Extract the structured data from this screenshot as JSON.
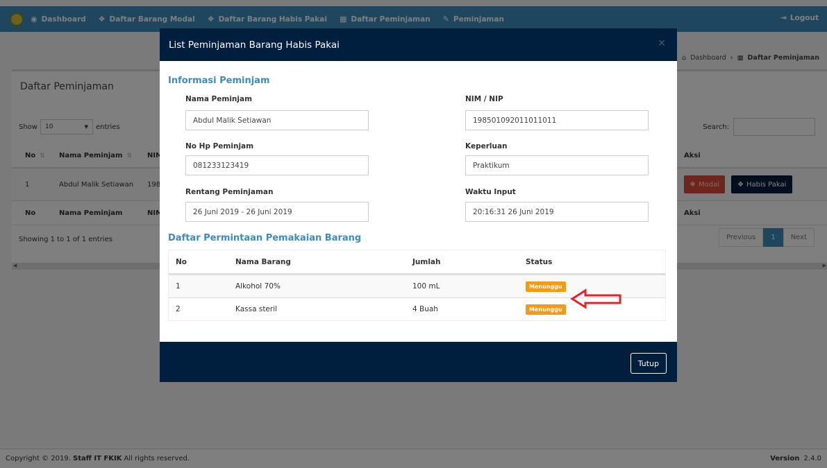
{
  "nav": {
    "items": [
      {
        "label": "Dashboard",
        "icon": "dashboard-icon"
      },
      {
        "label": "Daftar Barang Modal",
        "icon": "cubes-icon"
      },
      {
        "label": "Daftar Barang Habis Pakai",
        "icon": "cubes-icon"
      },
      {
        "label": "Daftar Peminjaman",
        "icon": "grid-icon"
      },
      {
        "label": "Peminjaman",
        "icon": "pencil-icon"
      }
    ],
    "logout": "Logout"
  },
  "breadcrumb": {
    "home": "Dashboard",
    "current": "Daftar Peminjaman"
  },
  "page": {
    "box_title": "Daftar Peminjaman",
    "show_label": "Show",
    "show_value": "10",
    "entries_label": "entries",
    "search_label": "Search:",
    "columns": {
      "no": "No",
      "nama": "Nama Peminjam",
      "nim": "NIM",
      "aksi": "Aksi"
    },
    "row": {
      "no": "1",
      "nama": "Abdul Malik Setiawan",
      "nim": "198"
    },
    "btn_modal": "Modal",
    "btn_habis": "Habis Pakai",
    "showing": "Showing 1 to 1 of 1 entries",
    "pagination": {
      "prev": "Previous",
      "page": "1",
      "next": "Next"
    }
  },
  "footer": {
    "copyright_prefix": "Copyright © 2019.",
    "owner": "Staff IT FKIK",
    "rights": "All rights reserved.",
    "version_label": "Version",
    "version": "2.4.0"
  },
  "modal": {
    "title": "List Peminjaman Barang Habis Pakai",
    "close": "×",
    "info_title": "Informasi Peminjam",
    "fields": {
      "nama_label": "Nama Peminjam",
      "nama_value": "Abdul Malik Setiawan",
      "nim_label": "NIM / NIP",
      "nim_value": "198501092011011011",
      "hp_label": "No Hp Peminjam",
      "hp_value": "081233123419",
      "keperluan_label": "Keperluan",
      "keperluan_value": "Praktikum",
      "rentang_label": "Rentang Peminjaman",
      "rentang_value": "26 Juni 2019 - 26 Juni 2019",
      "waktu_label": "Waktu Input",
      "waktu_value": "20:16:31 26 Juni 2019"
    },
    "list_title": "Daftar Permintaan Pemakaian Barang",
    "table": {
      "headers": {
        "no": "No",
        "nama": "Nama Barang",
        "jumlah": "Jumlah",
        "status": "Status"
      },
      "rows": [
        {
          "no": "1",
          "nama": "Alkohol 70%",
          "jumlah": "100 mL",
          "status": "Menunggu"
        },
        {
          "no": "2",
          "nama": "Kassa steril",
          "jumlah": "4 Buah",
          "status": "Menunggu"
        }
      ]
    },
    "tutup": "Tutup"
  },
  "colors": {
    "primary": "#3c8dbc",
    "navy": "#001f3f",
    "danger": "#dd4b39",
    "warning": "#f39c12",
    "annotation": "#e0242a"
  }
}
